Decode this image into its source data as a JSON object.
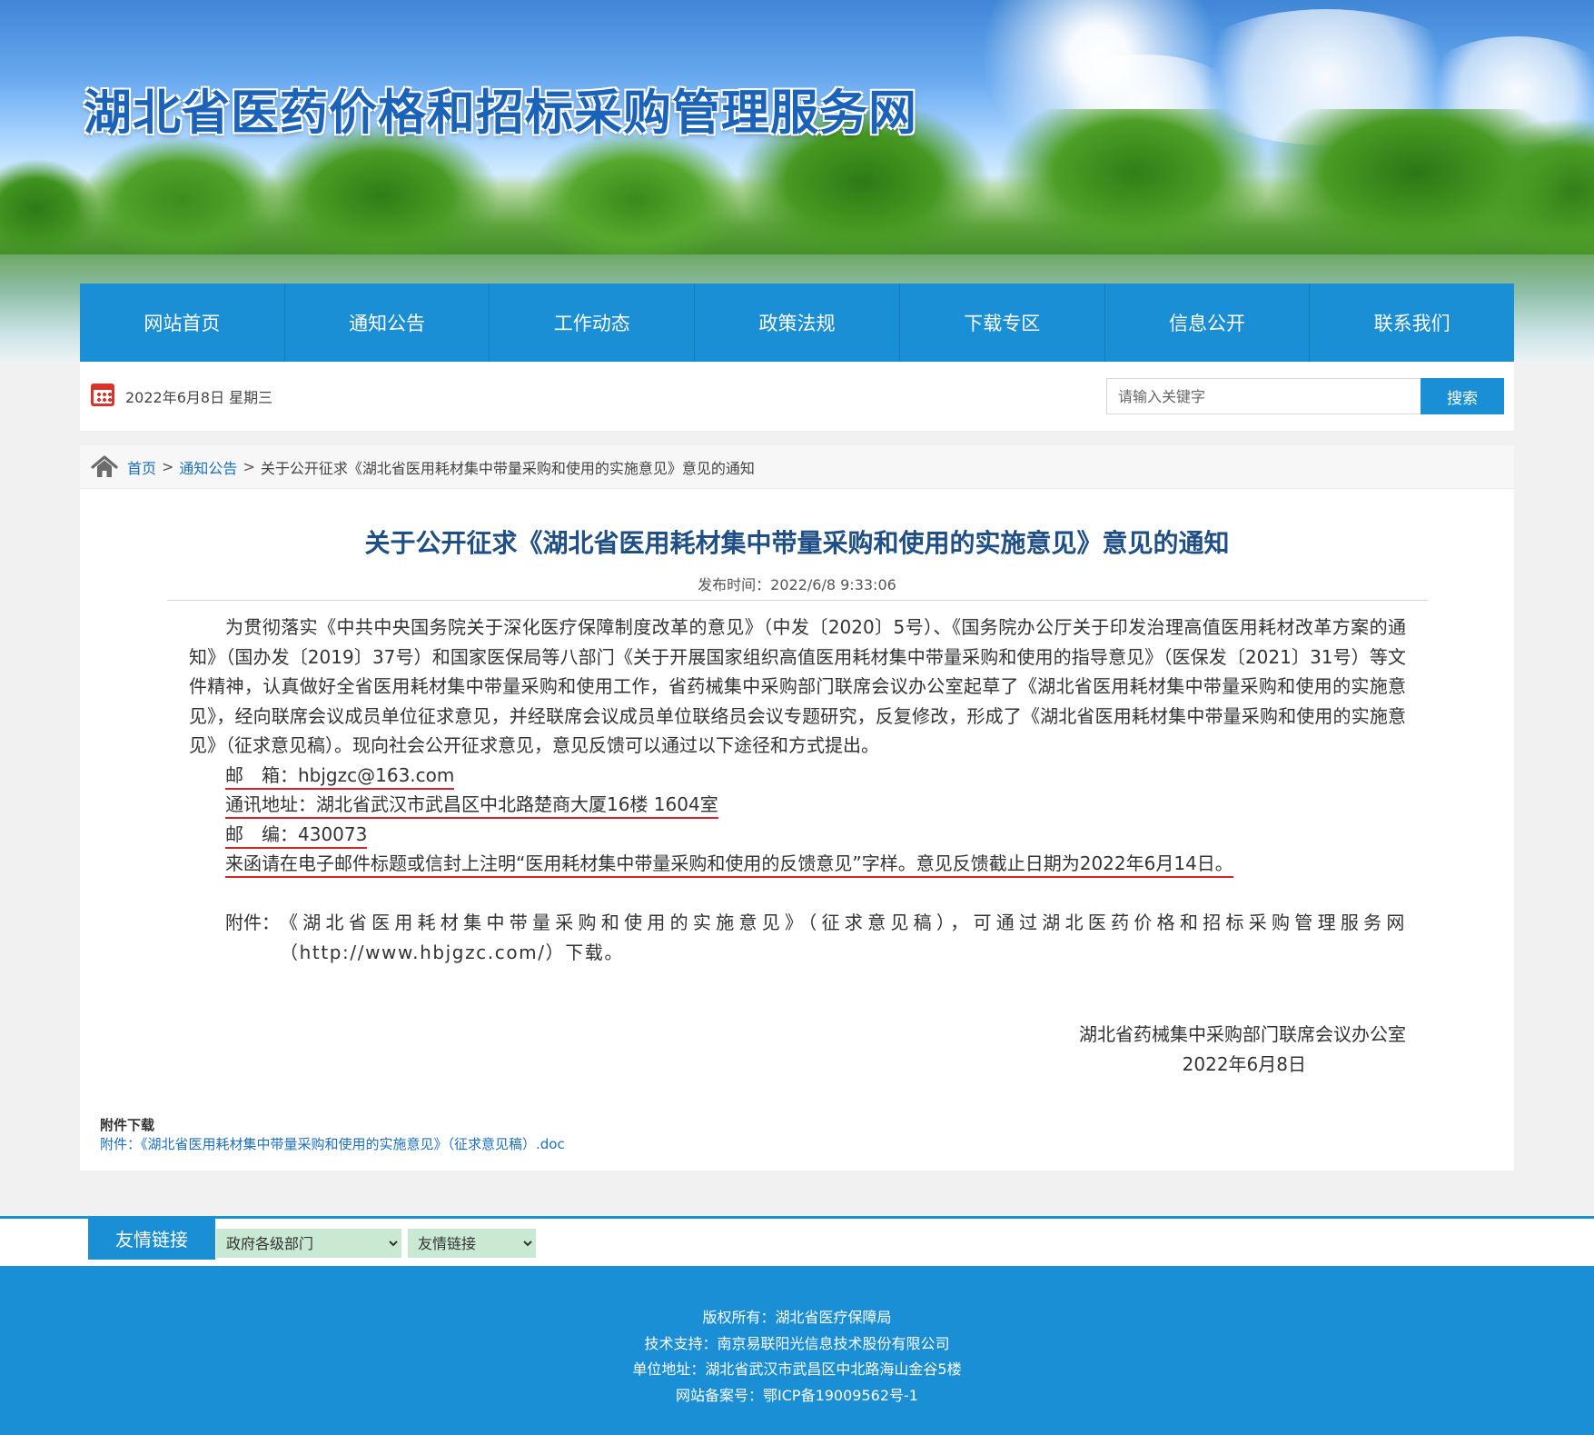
{
  "header": {
    "site_title": "湖北省医药价格和招标采购管理服务网"
  },
  "nav": {
    "items": [
      {
        "label": "网站首页"
      },
      {
        "label": "通知公告"
      },
      {
        "label": "工作动态"
      },
      {
        "label": "政策法规"
      },
      {
        "label": "下载专区"
      },
      {
        "label": "信息公开"
      },
      {
        "label": "联系我们"
      }
    ]
  },
  "infobar": {
    "date": "2022年6月8日 星期三",
    "search_placeholder": "请输入关键字",
    "search_button": "搜索"
  },
  "breadcrumb": {
    "home": "首页",
    "sep1": ">",
    "section": "通知公告",
    "sep2": ">",
    "current": "关于公开征求《湖北省医用耗材集中带量采购和使用的实施意见》意见的通知"
  },
  "article": {
    "title": "关于公开征求《湖北省医用耗材集中带量采购和使用的实施意见》意见的通知",
    "publish_time": "发布时间：2022/6/8 9:33:06",
    "intro": "为贯彻落实《中共中央国务院关于深化医疗保障制度改革的意见》（中发〔2020〕5号）、《国务院办公厅关于印发治理高值医用耗材改革方案的通知》（国办发〔2019〕37号）和国家医保局等八部门《关于开展国家组织高值医用耗材集中带量采购和使用的指导意见》（医保发〔2021〕31号）等文件精神，认真做好全省医用耗材集中带量采购和使用工作，省药械集中采购部门联席会议办公室起草了《湖北省医用耗材集中带量采购和使用的实施意见》，经向联席会议成员单位征求意见，并经联席会议成员单位联络员会议专题研究，反复修改，形成了《湖北省医用耗材集中带量采购和使用的实施意见》（征求意见稿）。现向社会公开征求意见，意见反馈可以通过以下途径和方式提出。",
    "email_line": "邮　箱：hbjgzc@163.com",
    "address_line": "通讯地址：湖北省武汉市武昌区中北路楚商大厦16楼 1604室",
    "postcode_line": "邮　编：430073",
    "notice_line": "来函请在电子邮件标题或信封上注明“医用耗材集中带量采购和使用的反馈意见”字样。意见反馈截止日期为2022年6月14日。",
    "attachment_label": "附件：",
    "attachment_text": "《湖北省医用耗材集中带量采购和使用的实施意见》（征求意见稿），可通过湖北医药价格和招标采购管理服务网（http://www.hbjgzc.com/）下载。",
    "signature_org": "湖北省药械集中采购部门联席会议办公室",
    "signature_date": "2022年6月8日"
  },
  "attachments": {
    "title": "附件下载",
    "link": "附件：《湖北省医用耗材集中带量采购和使用的实施意见》（征求意见稿）.doc"
  },
  "friend_links": {
    "tab_label": "友情链接",
    "select1": "政府各级部门",
    "select2": "友情链接"
  },
  "footer": {
    "copyright": "版权所有：湖北省医疗保障局",
    "support": "技术支持：南京易联阳光信息技术股份有限公司",
    "address": "单位地址：湖北省武汉市武昌区中北路海山金谷5楼",
    "icp": "网站备案号：鄂ICP备19009562号-1"
  },
  "colors": {
    "accent_blue": "#1b8fd6",
    "title_blue": "#1f4f87",
    "link_blue": "#1a6fc4",
    "underline_red": "#d9232a"
  }
}
